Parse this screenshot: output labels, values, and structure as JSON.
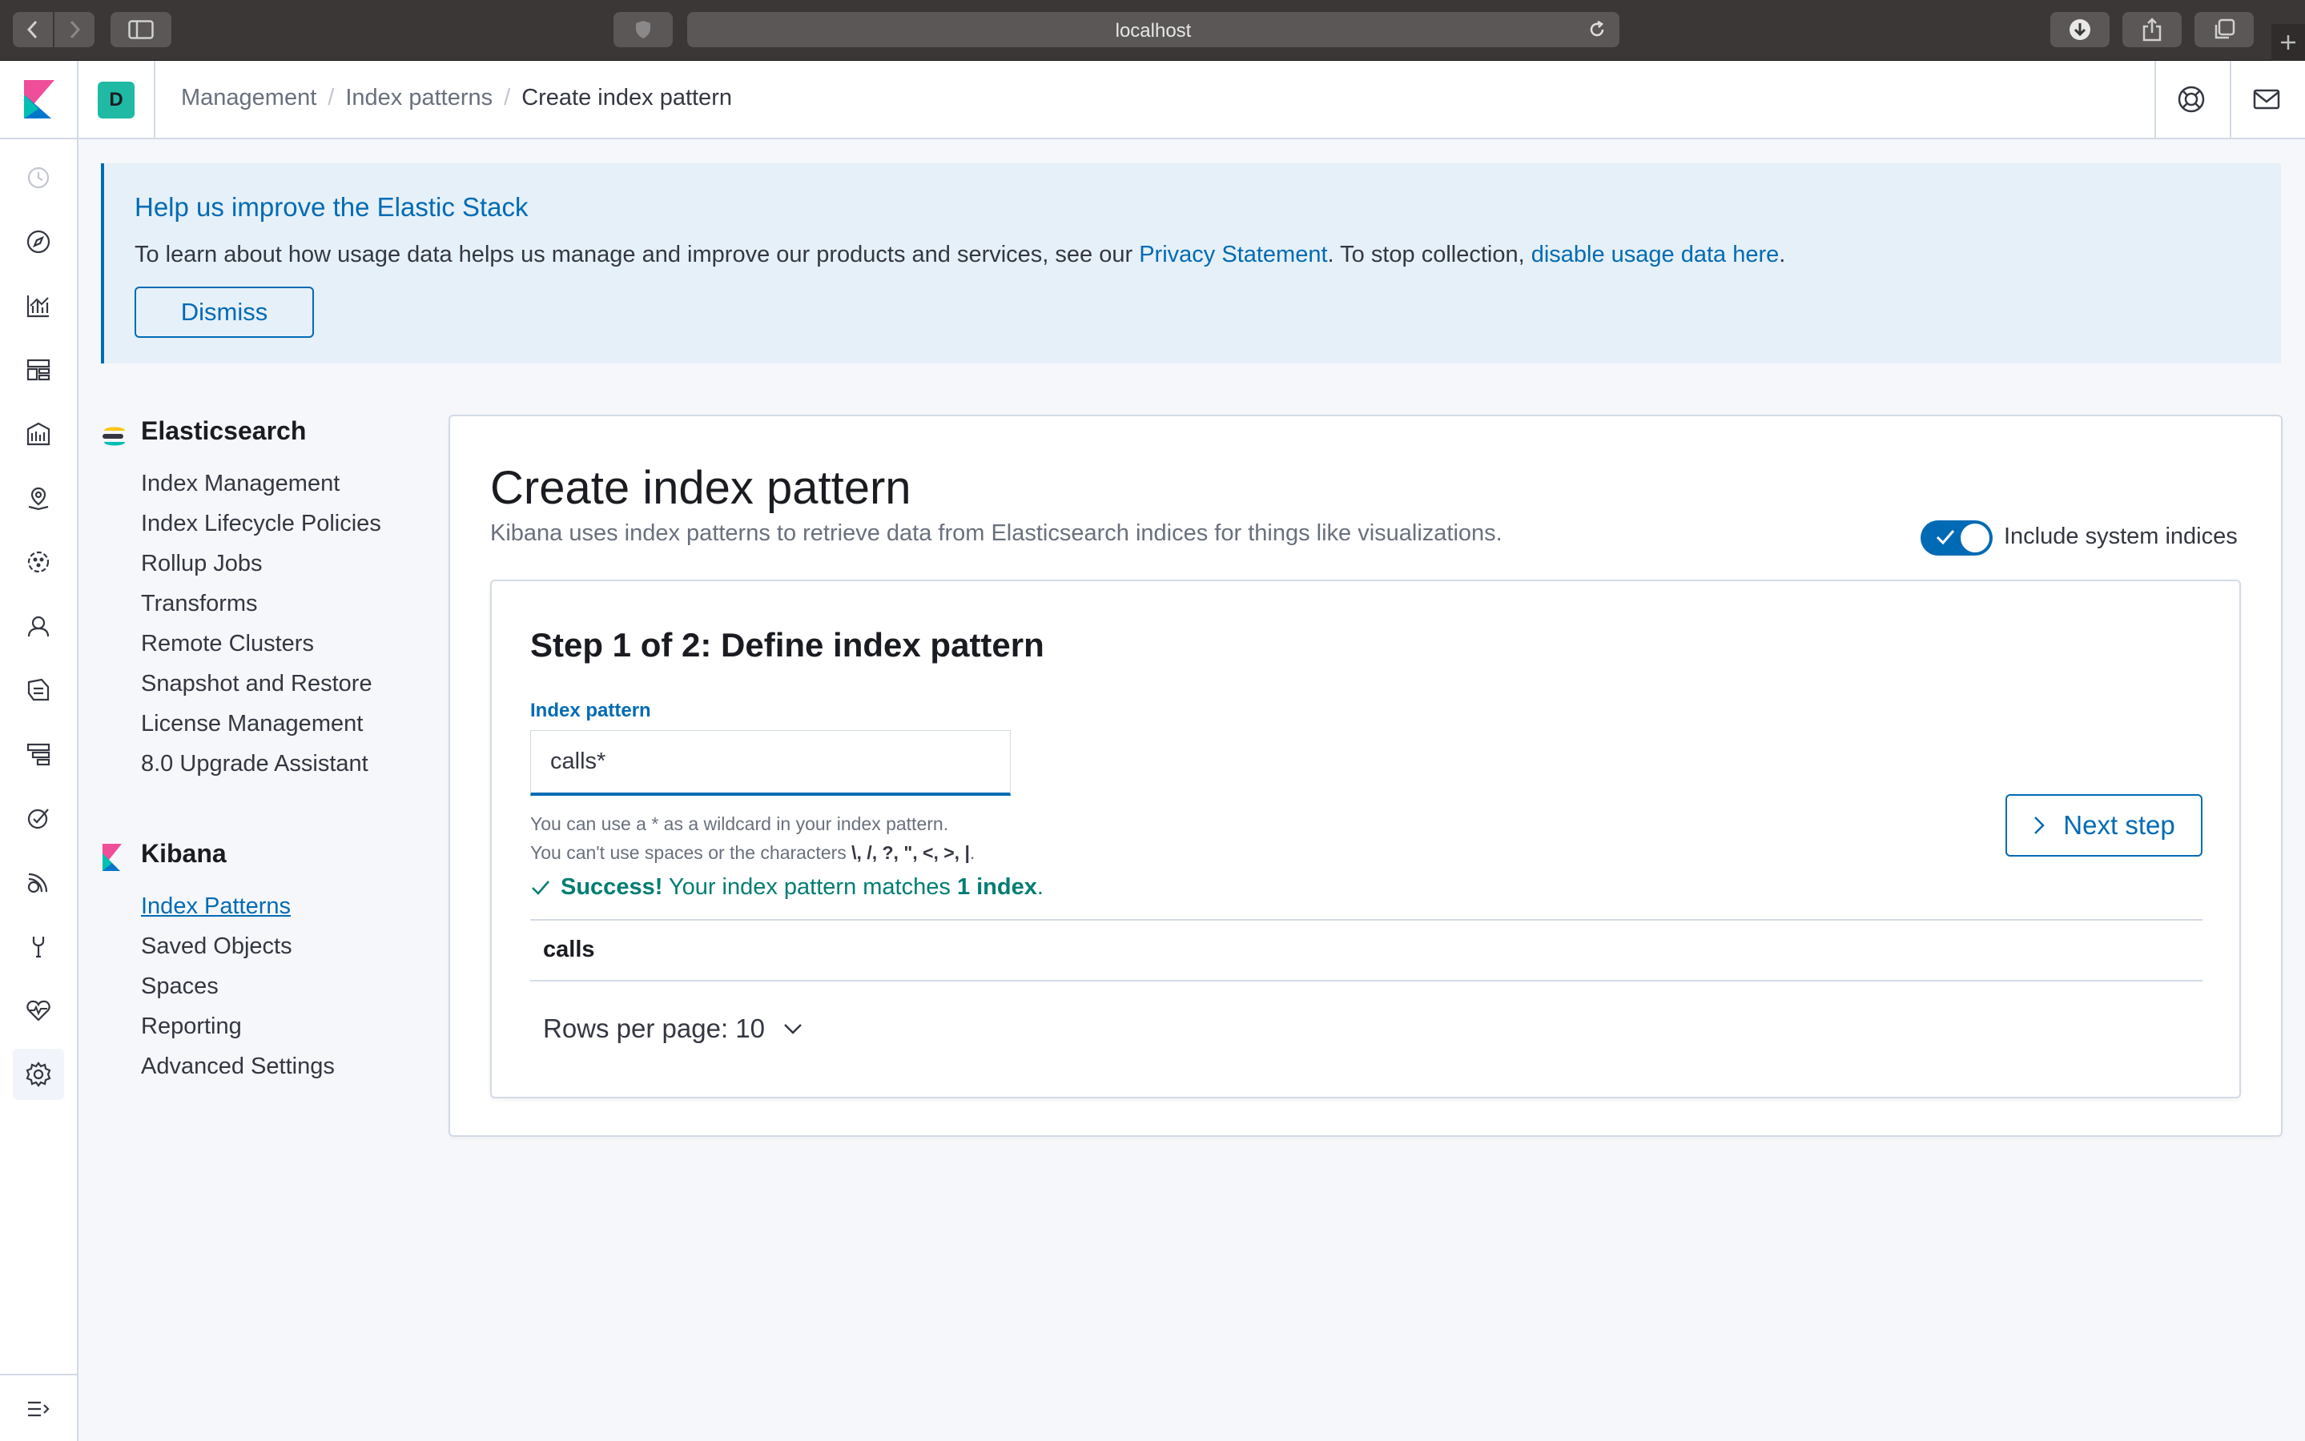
{
  "browser": {
    "url": "localhost",
    "icons": [
      "back-icon",
      "forward-icon",
      "sidebar-icon",
      "shield-icon",
      "reload-icon",
      "download-icon",
      "share-icon",
      "tabs-icon",
      "plus-icon"
    ]
  },
  "header": {
    "space_initial": "D",
    "breadcrumbs": [
      "Management",
      "Index patterns",
      "Create index pattern"
    ],
    "icons": [
      "help-icon",
      "mail-icon"
    ]
  },
  "left_nav": {
    "icons": [
      "recent-icon",
      "discover-icon",
      "visualize-icon",
      "dashboard-icon",
      "canvas-icon",
      "maps-icon",
      "ml-icon",
      "siem-icon",
      "logs-icon",
      "infrastructure-icon",
      "apm-icon",
      "uptime-icon",
      "dev-tools-icon",
      "monitoring-icon",
      "management-icon",
      "collapse-icon"
    ]
  },
  "callout": {
    "title": "Help us improve the Elastic Stack",
    "body_prefix": "To learn about how usage data helps us manage and improve our products and services, see our ",
    "privacy_link": "Privacy Statement",
    "body_middle": ". To stop collection, ",
    "disable_link": "disable usage data here",
    "body_suffix": ".",
    "dismiss_label": "Dismiss"
  },
  "side_menu": {
    "elasticsearch": {
      "title": "Elasticsearch",
      "items": [
        "Index Management",
        "Index Lifecycle Policies",
        "Rollup Jobs",
        "Transforms",
        "Remote Clusters",
        "Snapshot and Restore",
        "License Management",
        "8.0 Upgrade Assistant"
      ]
    },
    "kibana": {
      "title": "Kibana",
      "items": [
        "Index Patterns",
        "Saved Objects",
        "Spaces",
        "Reporting",
        "Advanced Settings"
      ],
      "active_index": 0
    }
  },
  "main": {
    "title": "Create index pattern",
    "description": "Kibana uses index patterns to retrieve data from Elasticsearch indices for things like visualizations.",
    "toggle_label": "Include system indices",
    "toggle_on": true,
    "step_title": "Step 1 of 2: Define index pattern",
    "field_label": "Index pattern",
    "field_value": "calls*",
    "help_line1": "You can use a * as a wildcard in your index pattern.",
    "help_line2_prefix": "You can't use spaces or the characters ",
    "help_line2_chars": "\\, /, ?, \", <, >, |",
    "help_line2_suffix": ".",
    "success_bold": "Success!",
    "success_text": " Your index pattern matches ",
    "success_count": "1 index",
    "success_end": ".",
    "next_label": "Next step",
    "table_rows": [
      "calls"
    ],
    "rows_per_page": "Rows per page: 10"
  },
  "colors": {
    "primary": "#006bb4",
    "success": "#017d73",
    "callout_bg": "#e6f0f8",
    "space_badge": "#20b9a4"
  }
}
